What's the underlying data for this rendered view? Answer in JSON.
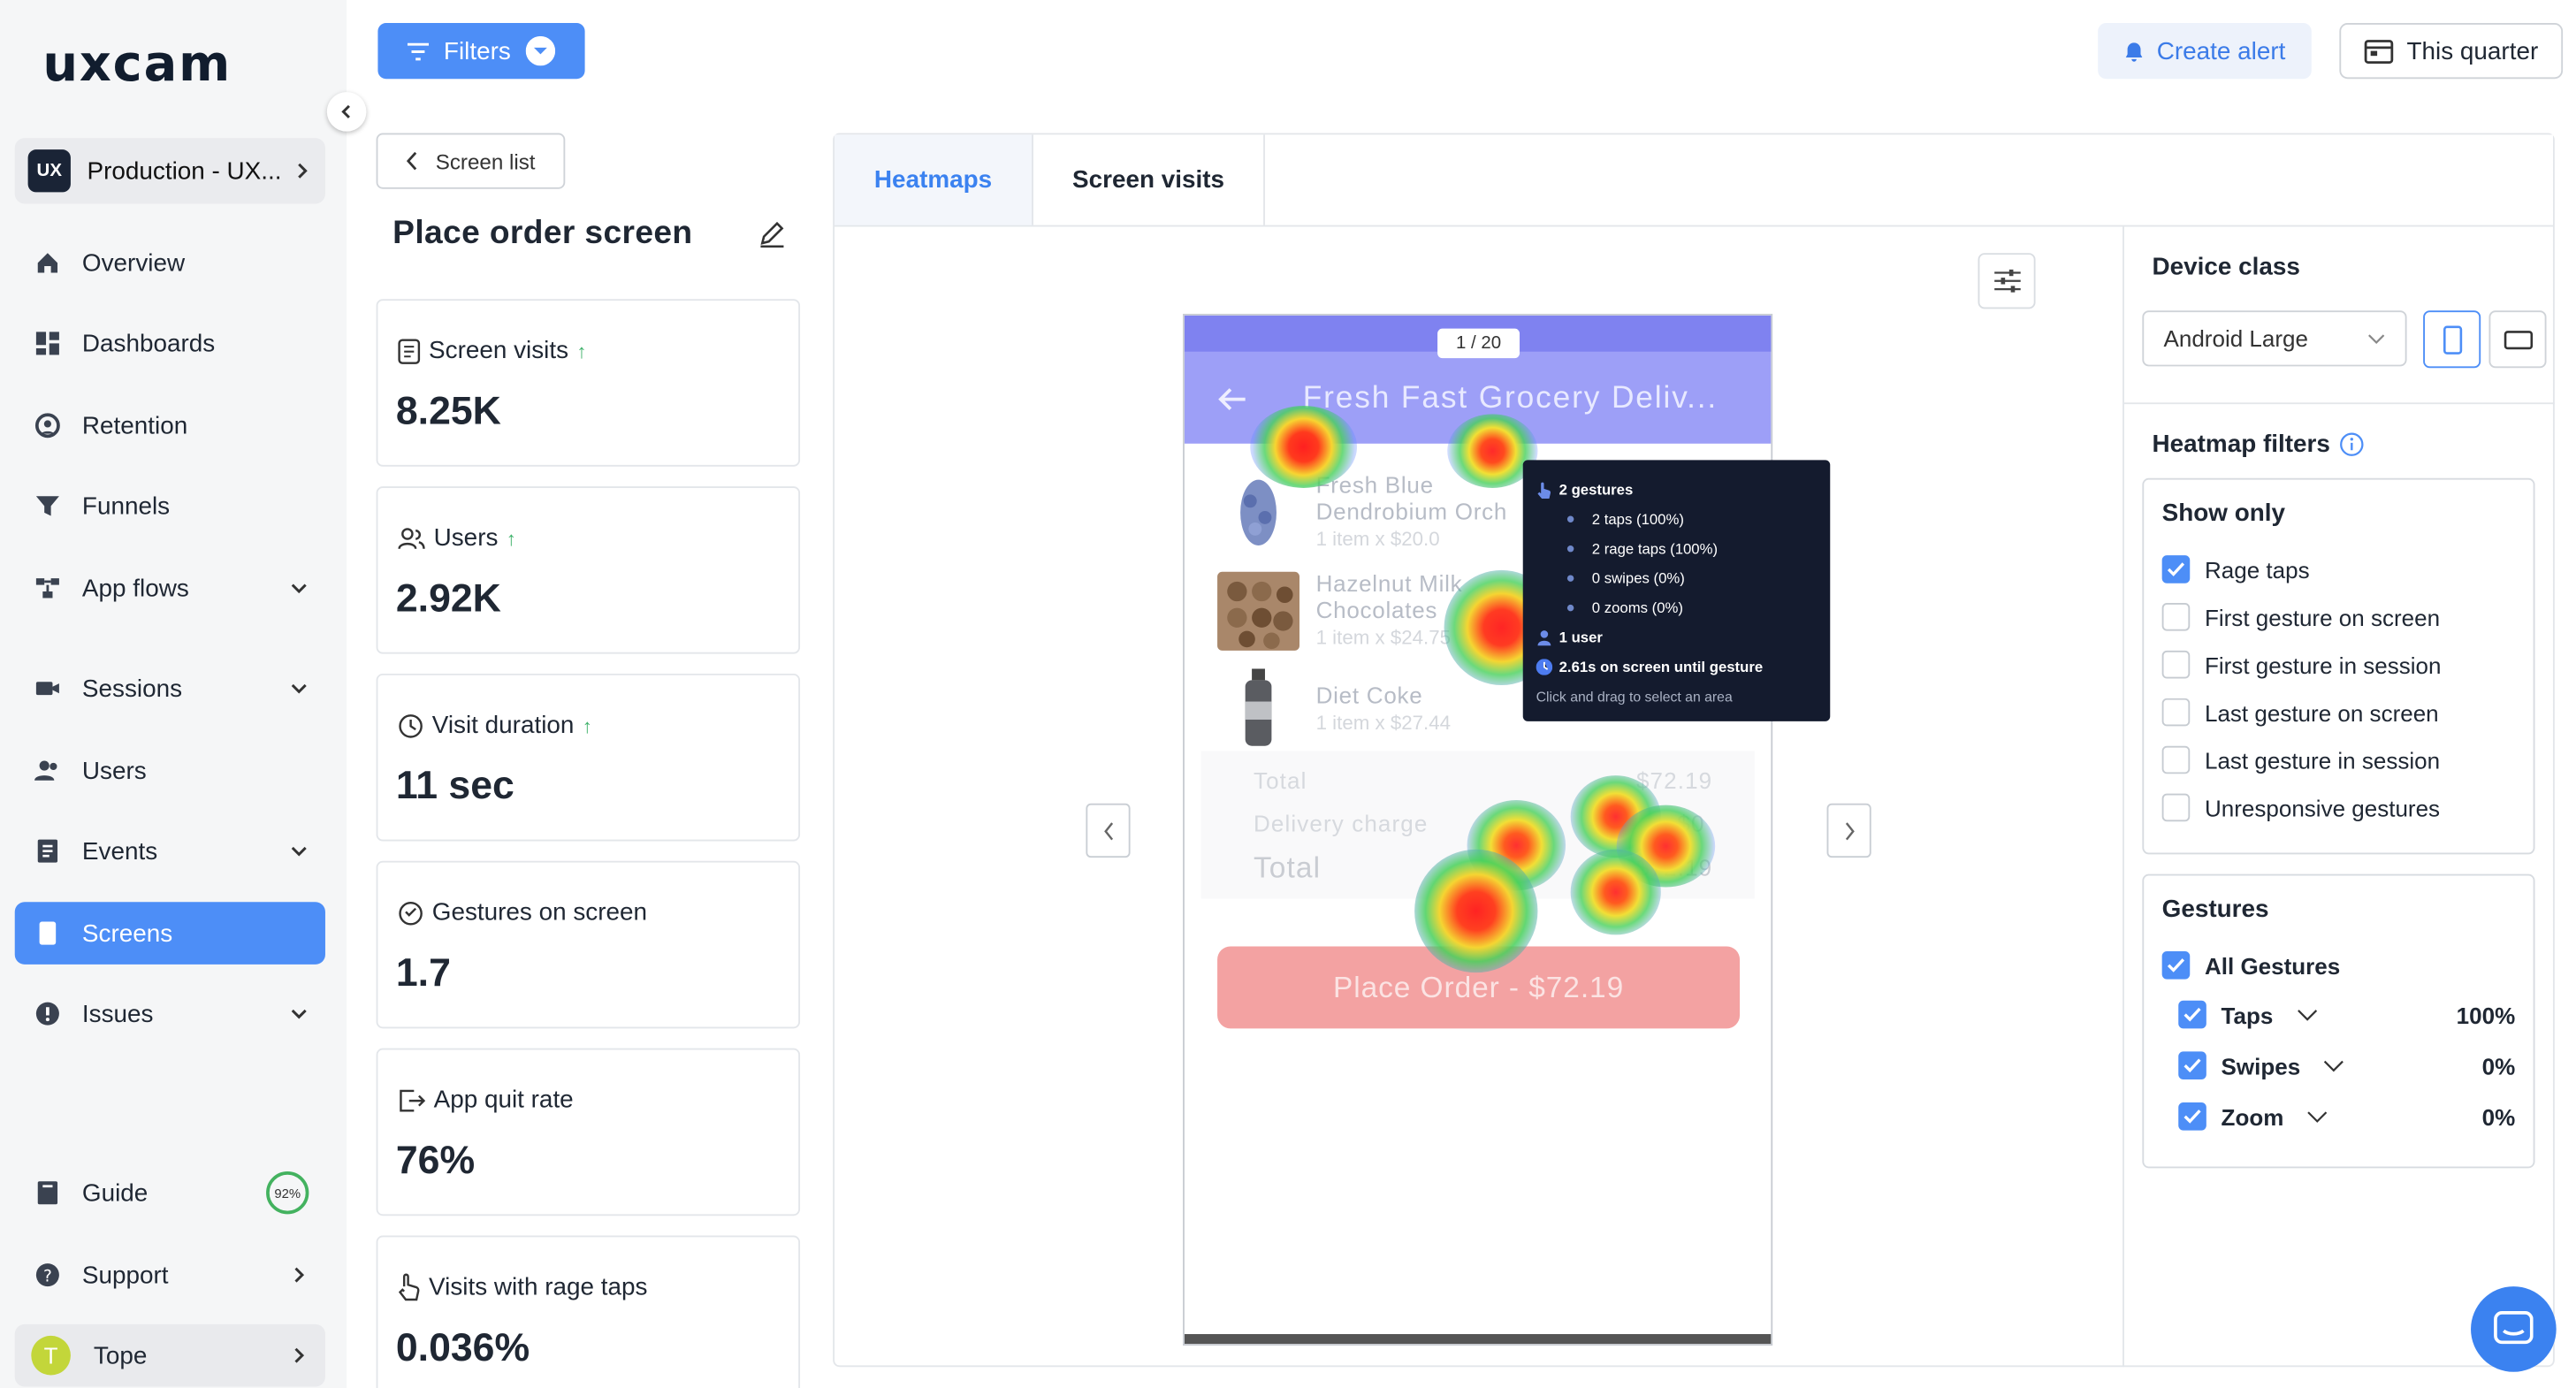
{
  "sidebar": {
    "logo": "uxcam",
    "project": {
      "badge": "UX",
      "name": "Production - UX..."
    },
    "nav": [
      {
        "label": "Overview",
        "icon": "home-icon"
      },
      {
        "label": "Dashboards",
        "icon": "dashboard-icon"
      },
      {
        "label": "Retention",
        "icon": "retention-icon"
      },
      {
        "label": "Funnels",
        "icon": "funnel-icon"
      },
      {
        "label": "App flows",
        "icon": "app-flows-icon"
      },
      {
        "label": "Sessions",
        "icon": "sessions-icon"
      },
      {
        "label": "Users",
        "icon": "users-icon"
      },
      {
        "label": "Events",
        "icon": "events-icon"
      },
      {
        "label": "Screens",
        "icon": "screens-icon"
      },
      {
        "label": "Issues",
        "icon": "issues-icon"
      },
      {
        "label": "Guide",
        "icon": "guide-icon",
        "badge": "92%"
      },
      {
        "label": "Support",
        "icon": "support-icon"
      }
    ],
    "user": {
      "initial": "T",
      "name": "Tope"
    }
  },
  "topbar": {
    "filters": "Filters",
    "create_alert": "Create alert",
    "date_range": "This quarter"
  },
  "left": {
    "screen_list": "Screen list",
    "title": "Place order screen",
    "metrics": [
      {
        "label": "Screen visits",
        "value": "8.25K",
        "trend": "up"
      },
      {
        "label": "Users",
        "value": "2.92K",
        "trend": "up"
      },
      {
        "label": "Visit duration",
        "value": "11 sec",
        "trend": "up"
      },
      {
        "label": "Gestures on screen",
        "value": "1.7"
      },
      {
        "label": "App quit rate",
        "value": "76%"
      },
      {
        "label": "Visits with rage taps",
        "value": "0.036%"
      }
    ]
  },
  "tabs": [
    "Heatmaps",
    "Screen visits"
  ],
  "phone": {
    "page_indicator": "1 / 20",
    "title": "Fresh Fast Grocery Deliv...",
    "items": [
      {
        "name1": "Fresh Blue",
        "name2": "Dendrobium Orch",
        "sub": "1 item x $20.0"
      },
      {
        "name1": "Hazelnut Milk",
        "name2": "Chocolates",
        "sub": "1 item x $24.75"
      },
      {
        "name1": "Diet Coke",
        "name2": "",
        "sub": "1 item x $27.44"
      }
    ],
    "total_label": "Total",
    "total_value": "$72.19",
    "delivery_label": "Delivery charge",
    "delivery_value": "$0",
    "grand_label": "Total",
    "grand_value": "$72.19",
    "button": "Place Order - $72.19"
  },
  "tooltip": {
    "gestures": "2 gestures",
    "taps": "2 taps (100%)",
    "rage": "2 rage taps (100%)",
    "swipes": "0 swipes (0%)",
    "zooms": "0 zooms (0%)",
    "users": "1 user",
    "time": "2.61s on screen until gesture",
    "hint": "Click and drag to select an area"
  },
  "right": {
    "device_class_title": "Device class",
    "device_select": "Android Large",
    "heatmap_filters_title": "Heatmap filters",
    "show_only_title": "Show only",
    "show_only": [
      {
        "label": "Rage taps",
        "checked": true
      },
      {
        "label": "First gesture on screen",
        "checked": false
      },
      {
        "label": "First gesture in session",
        "checked": false
      },
      {
        "label": "Last gesture on screen",
        "checked": false
      },
      {
        "label": "Last gesture in session",
        "checked": false
      },
      {
        "label": "Unresponsive gestures",
        "checked": false
      }
    ],
    "gestures_title": "Gestures",
    "all_gestures": "All Gestures",
    "gestures": [
      {
        "label": "Taps",
        "pct": "100%"
      },
      {
        "label": "Swipes",
        "pct": "0%"
      },
      {
        "label": "Zoom",
        "pct": "0%"
      }
    ]
  },
  "colors": {
    "accent": "#4d8ef7",
    "heat_red": "#ff2a2a",
    "heat_green": "#46d05a",
    "tooltip_bg": "#141b2e"
  }
}
